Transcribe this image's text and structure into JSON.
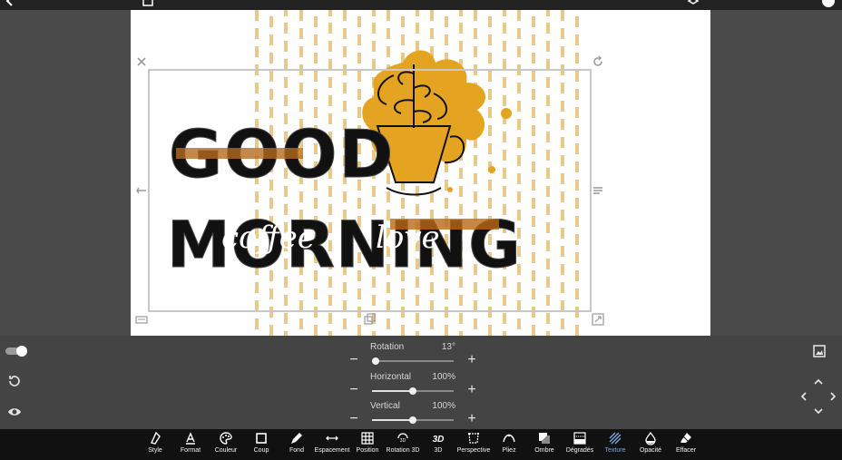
{
  "canvas": {
    "headline_line1": "GOOD",
    "headline_line2": "MORNING",
    "script_words": [
      "coffee",
      "love"
    ],
    "accent_color": "#e5a322",
    "stripe_color": "#e8c988"
  },
  "sliders": [
    {
      "label": "Rotation",
      "value_text": "13°",
      "fraction": 0.0
    },
    {
      "label": "Horizontal",
      "value_text": "100%",
      "fraction": 0.5
    },
    {
      "label": "Vertical",
      "value_text": "100%",
      "fraction": 0.5
    }
  ],
  "side_controls": {
    "toggle_on": true,
    "icons": [
      "toggle-switch",
      "reset-icon",
      "visibility-icon",
      "image-icon"
    ]
  },
  "toolbar": {
    "items": [
      {
        "label": "Style",
        "icon": "style-icon"
      },
      {
        "label": "Format",
        "icon": "format-icon"
      },
      {
        "label": "Couleur",
        "icon": "palette-icon"
      },
      {
        "label": "Coup",
        "icon": "stroke-icon"
      },
      {
        "label": "Fond",
        "icon": "brush-icon"
      },
      {
        "label": "Espacement",
        "icon": "spacing-icon"
      },
      {
        "label": "Position",
        "icon": "grid-icon"
      },
      {
        "label": "Rotation 3D",
        "icon": "rotation-3d-icon"
      },
      {
        "label": "3D",
        "icon": "3d-icon"
      },
      {
        "label": "Perspective",
        "icon": "perspective-icon"
      },
      {
        "label": "Pliez",
        "icon": "bend-icon"
      },
      {
        "label": "Ombre",
        "icon": "shadow-icon"
      },
      {
        "label": "Dégradés",
        "icon": "gradient-icon"
      },
      {
        "label": "Texture",
        "icon": "texture-icon"
      },
      {
        "label": "Opacité",
        "icon": "opacity-icon"
      },
      {
        "label": "Effacer",
        "icon": "eraser-icon"
      }
    ],
    "active": "Texture",
    "active_color": "#7aa7e6"
  }
}
